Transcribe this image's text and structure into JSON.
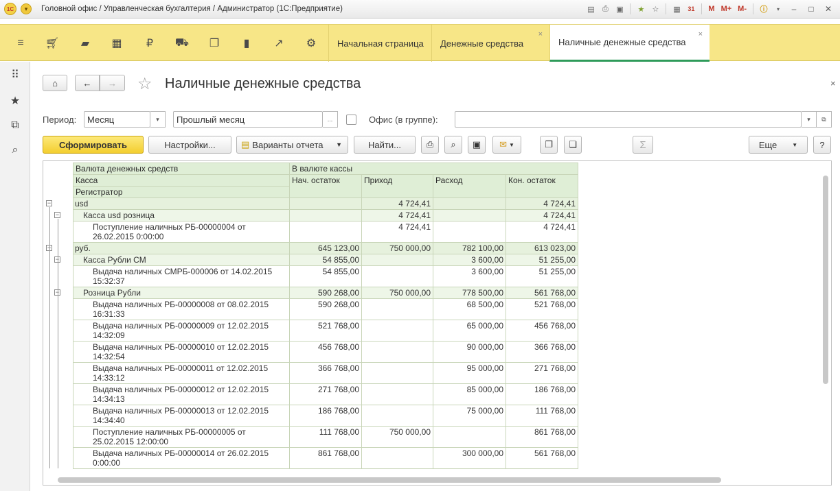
{
  "window": {
    "title": "Головной офис / Управленческая бухгалтерия / Администратор  (1С:Предприятие)",
    "logo": "1С",
    "tools": [
      "save-icon",
      "print-icon",
      "preview-icon",
      "favorite-add-icon",
      "star-icon",
      "calculator-icon",
      "calendar-icon"
    ],
    "m_labels": [
      "M",
      "M+",
      "M-"
    ],
    "info_icon": "i",
    "calendar_day": "31"
  },
  "sections": {
    "icons": [
      "menu-icon",
      "cart-icon",
      "bag-icon",
      "grid-icon",
      "money-icon",
      "truck-icon",
      "documents-icon",
      "bar-chart-icon",
      "trend-icon",
      "gear-icon"
    ],
    "tabs": [
      {
        "label": "Начальная страница"
      },
      {
        "label": "Денежные средства",
        "close": "×"
      },
      {
        "label": "Наличные денежные средства",
        "close": "×"
      }
    ]
  },
  "page": {
    "title": "Наличные денежные средства",
    "close": "×",
    "period_label": "Период:",
    "period_type": "Месяц",
    "period_value": "Прошлый месяц",
    "office_label": "Офис (в группе):",
    "office_value": "",
    "ellipsis": "...",
    "toolbar": {
      "generate": "Сформировать",
      "settings": "Настройки...",
      "variants": "Варианты отчета",
      "find": "Найти...",
      "more": "Еще",
      "help": "?",
      "sigma": "Σ"
    }
  },
  "report": {
    "headers": {
      "group1": "Валюта денежных средств",
      "group2": "Касса",
      "group3": "Регистратор",
      "currency": "В валюте кассы",
      "columns": [
        "Нач. остаток",
        "Приход",
        "Расход",
        "Кон. остаток"
      ]
    },
    "rows": [
      {
        "level": 1,
        "name": "usd",
        "cells": [
          "",
          "4 724,41",
          "",
          "4 724,41"
        ]
      },
      {
        "level": 2,
        "name": "Касса usd розница",
        "cells": [
          "",
          "4 724,41",
          "",
          "4 724,41"
        ]
      },
      {
        "level": 3,
        "name": "Поступление наличных РБ-00000004 от",
        "name2": "26.02.2015 0:00:00",
        "cells": [
          "",
          "4 724,41",
          "",
          "4 724,41"
        ]
      },
      {
        "level": 1,
        "name": "руб.",
        "cells": [
          "645 123,00",
          "750 000,00",
          "782 100,00",
          "613 023,00"
        ]
      },
      {
        "level": 2,
        "name": "Касса Рубли СМ",
        "cells": [
          "54 855,00",
          "",
          "3 600,00",
          "51 255,00"
        ]
      },
      {
        "level": 3,
        "name": "Выдача наличных СМРБ-000006 от 14.02.2015",
        "name2": "15:32:37",
        "cells": [
          "54 855,00",
          "",
          "3 600,00",
          "51 255,00"
        ]
      },
      {
        "level": 2,
        "name": "Розница Рубли",
        "cells": [
          "590 268,00",
          "750 000,00",
          "778 500,00",
          "561 768,00"
        ]
      },
      {
        "level": 3,
        "name": "Выдача наличных РБ-00000008 от 08.02.2015",
        "name2": "16:31:33",
        "cells": [
          "590 268,00",
          "",
          "68 500,00",
          "521 768,00"
        ]
      },
      {
        "level": 3,
        "name": "Выдача наличных РБ-00000009 от 12.02.2015",
        "name2": "14:32:09",
        "cells": [
          "521 768,00",
          "",
          "65 000,00",
          "456 768,00"
        ]
      },
      {
        "level": 3,
        "name": "Выдача наличных РБ-00000010 от 12.02.2015",
        "name2": "14:32:54",
        "cells": [
          "456 768,00",
          "",
          "90 000,00",
          "366 768,00"
        ]
      },
      {
        "level": 3,
        "name": "Выдача наличных РБ-00000011 от 12.02.2015",
        "name2": "14:33:12",
        "cells": [
          "366 768,00",
          "",
          "95 000,00",
          "271 768,00"
        ]
      },
      {
        "level": 3,
        "name": "Выдача наличных РБ-00000012 от 12.02.2015",
        "name2": "14:34:13",
        "cells": [
          "271 768,00",
          "",
          "85 000,00",
          "186 768,00"
        ]
      },
      {
        "level": 3,
        "name": "Выдача наличных РБ-00000013 от 12.02.2015",
        "name2": "14:34:40",
        "cells": [
          "186 768,00",
          "",
          "75 000,00",
          "111 768,00"
        ]
      },
      {
        "level": 3,
        "name": "Поступление наличных РБ-00000005 от",
        "name2": "25.02.2015 12:00:00",
        "cells": [
          "111 768,00",
          "750 000,00",
          "",
          "861 768,00"
        ]
      },
      {
        "level": 3,
        "name": "Выдача наличных РБ-00000014 от 26.02.2015",
        "name2": "0:00:00",
        "cells": [
          "861 768,00",
          "",
          "300 000,00",
          "561 768,00"
        ]
      }
    ]
  }
}
